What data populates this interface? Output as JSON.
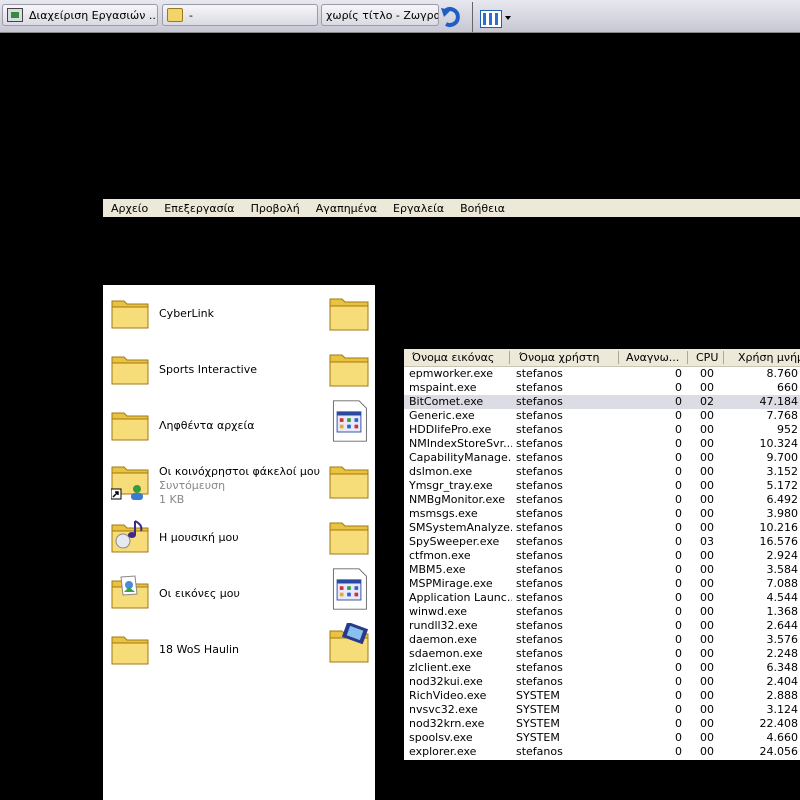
{
  "taskbar": {
    "buttons": [
      {
        "label": "Διαχείριση Εργασιών ...",
        "icon": "task-manager-icon"
      },
      {
        "label": "-",
        "icon": "folder-icon"
      },
      {
        "label": "χωρίς τίτλο - Ζωγραφική",
        "icon": "paint-icon"
      }
    ],
    "quick_launch": [
      "undo-arrow-icon",
      "grid-window-icon"
    ]
  },
  "menu": [
    "Αρχείο",
    "Επεξεργασία",
    "Προβολή",
    "Αγαπημένα",
    "Εργαλεία",
    "Βοήθεια"
  ],
  "explorer": {
    "items": [
      {
        "label": "CyberLink"
      },
      {
        "label": "Sports Interactive"
      },
      {
        "label": "Ληφθέντα αρχεία"
      },
      {
        "label": "Οι κοινόχρηστοι φάκελοί μου",
        "type": "Συντόμευση",
        "size": "1 KB"
      },
      {
        "label": "Η μουσική μου"
      },
      {
        "label": "Οι εικόνες μου"
      },
      {
        "label": "18 WoS Haulin"
      }
    ]
  },
  "task_manager": {
    "columns": [
      "Όνομα εικόνας",
      "Όνομα χρήστη",
      "Αναγνω...",
      "CPU",
      "Χρήση μνήμη"
    ],
    "selected_row": 2,
    "rows": [
      [
        "epmworker.exe",
        "stefanos",
        "0",
        "00",
        "8.760"
      ],
      [
        "mspaint.exe",
        "stefanos",
        "0",
        "00",
        "660"
      ],
      [
        "BitComet.exe",
        "stefanos",
        "0",
        "02",
        "47.184"
      ],
      [
        "Generic.exe",
        "stefanos",
        "0",
        "00",
        "7.768"
      ],
      [
        "HDDlifePro.exe",
        "stefanos",
        "0",
        "00",
        "952"
      ],
      [
        "NMIndexStoreSvr...",
        "stefanos",
        "0",
        "00",
        "10.324"
      ],
      [
        "CapabilityManage...",
        "stefanos",
        "0",
        "00",
        "9.700"
      ],
      [
        "dslmon.exe",
        "stefanos",
        "0",
        "00",
        "3.152"
      ],
      [
        "Ymsgr_tray.exe",
        "stefanos",
        "0",
        "00",
        "5.172"
      ],
      [
        "NMBgMonitor.exe",
        "stefanos",
        "0",
        "00",
        "6.492"
      ],
      [
        "msmsgs.exe",
        "stefanos",
        "0",
        "00",
        "3.980"
      ],
      [
        "SMSystemAnalyze...",
        "stefanos",
        "0",
        "00",
        "10.216"
      ],
      [
        "SpySweeper.exe",
        "stefanos",
        "0",
        "03",
        "16.576"
      ],
      [
        "ctfmon.exe",
        "stefanos",
        "0",
        "00",
        "2.924"
      ],
      [
        "MBM5.exe",
        "stefanos",
        "0",
        "00",
        "3.584"
      ],
      [
        "MSPMirage.exe",
        "stefanos",
        "0",
        "00",
        "7.088"
      ],
      [
        "Application Launc...",
        "stefanos",
        "0",
        "00",
        "4.544"
      ],
      [
        "winwd.exe",
        "stefanos",
        "0",
        "00",
        "1.368"
      ],
      [
        "rundll32.exe",
        "stefanos",
        "0",
        "00",
        "2.644"
      ],
      [
        "daemon.exe",
        "stefanos",
        "0",
        "00",
        "3.576"
      ],
      [
        "sdaemon.exe",
        "stefanos",
        "0",
        "00",
        "2.248"
      ],
      [
        "zlclient.exe",
        "stefanos",
        "0",
        "00",
        "6.348"
      ],
      [
        "nod32kui.exe",
        "stefanos",
        "0",
        "00",
        "2.404"
      ],
      [
        "RichVideo.exe",
        "SYSTEM",
        "0",
        "00",
        "2.888"
      ],
      [
        "nvsvc32.exe",
        "SYSTEM",
        "0",
        "00",
        "3.124"
      ],
      [
        "nod32krn.exe",
        "SYSTEM",
        "0",
        "00",
        "22.408"
      ],
      [
        "spoolsv.exe",
        "SYSTEM",
        "0",
        "00",
        "4.660"
      ],
      [
        "explorer.exe",
        "stefanos",
        "0",
        "00",
        "24.056"
      ]
    ]
  }
}
